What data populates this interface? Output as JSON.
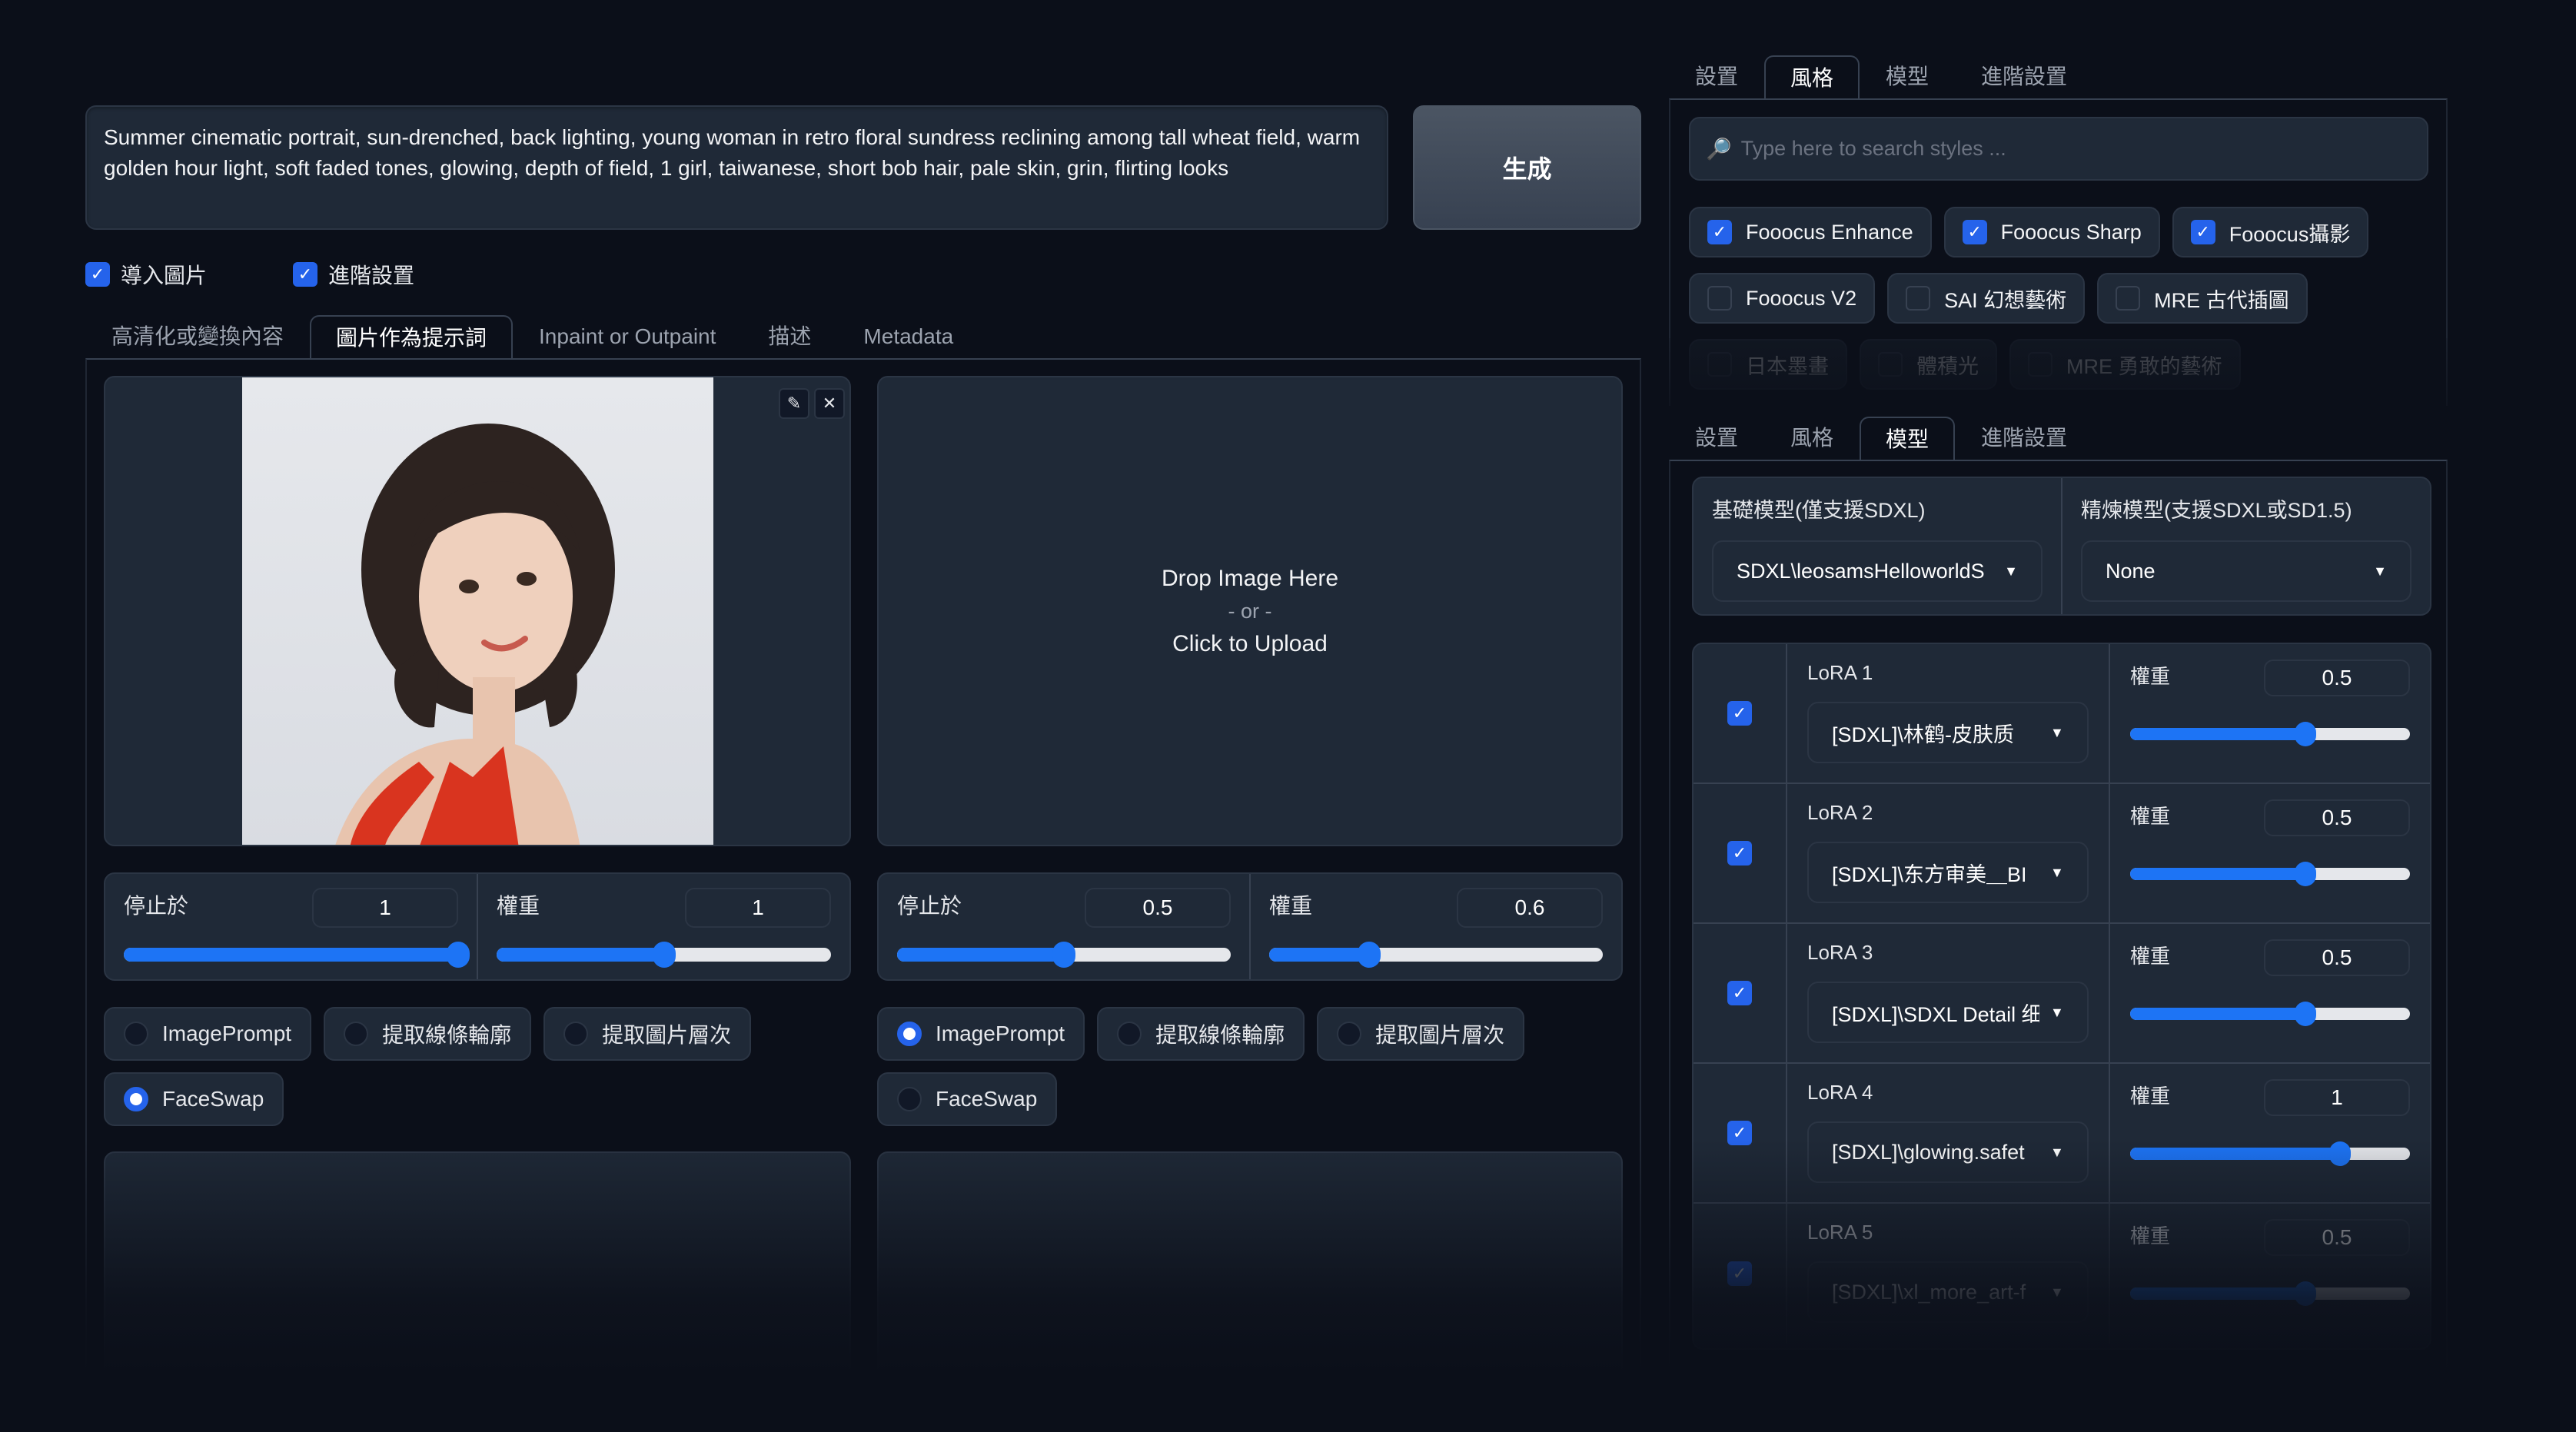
{
  "prompt": {
    "text": "Summer cinematic portrait, sun-drenched, back lighting, young woman in retro floral sundress reclining among tall wheat field, warm golden hour light, soft faded tones, glowing, depth of field, 1 girl, taiwanese, short bob hair, pale skin, grin, flirting looks"
  },
  "generate_button": "生成",
  "options": [
    {
      "label": "導入圖片",
      "checked": true
    },
    {
      "label": "進階設置",
      "checked": true
    }
  ],
  "input_tabs": [
    {
      "label": "高清化或變換內容",
      "active": false
    },
    {
      "label": "圖片作為提示詞",
      "active": true
    },
    {
      "label": "Inpaint or Outpaint",
      "active": false
    },
    {
      "label": "描述",
      "active": false
    },
    {
      "label": "Metadata",
      "active": false
    }
  ],
  "image_slots": [
    {
      "has_image": true,
      "image_alt": "portrait of young woman with short bob hair in red top",
      "stop_at": {
        "label": "停止於",
        "value": "1",
        "fraction": 1.0
      },
      "weight": {
        "label": "權重",
        "value": "1",
        "fraction": 0.5
      },
      "types": [
        {
          "label": "ImagePrompt",
          "selected": false
        },
        {
          "label": "提取線條輪廓",
          "selected": false
        },
        {
          "label": "提取圖片層次",
          "selected": false
        },
        {
          "label": "FaceSwap",
          "selected": true
        }
      ]
    },
    {
      "has_image": false,
      "drop_text": "Drop Image Here",
      "or_text": "- or -",
      "upload_text": "Click to Upload",
      "stop_at": {
        "label": "停止於",
        "value": "0.5",
        "fraction": 0.5
      },
      "weight": {
        "label": "權重",
        "value": "0.6",
        "fraction": 0.3
      },
      "types": [
        {
          "label": "ImagePrompt",
          "selected": true
        },
        {
          "label": "提取線條輪廓",
          "selected": false
        },
        {
          "label": "提取圖片層次",
          "selected": false
        },
        {
          "label": "FaceSwap",
          "selected": false
        }
      ]
    }
  ],
  "settings_tabs_top": [
    {
      "label": "設置",
      "active": false
    },
    {
      "label": "風格",
      "active": true
    },
    {
      "label": "模型",
      "active": false
    },
    {
      "label": "進階設置",
      "active": false
    }
  ],
  "style_search": {
    "placeholder": "Type here to search styles ..."
  },
  "styles": [
    [
      {
        "label": "Fooocus Enhance",
        "checked": true
      },
      {
        "label": "Fooocus Sharp",
        "checked": true
      },
      {
        "label": "Fooocus攝影",
        "checked": true
      }
    ],
    [
      {
        "label": "Fooocus V2",
        "checked": false
      },
      {
        "label": "SAI 幻想藝術",
        "checked": false
      },
      {
        "label": "MRE 古代插圖",
        "checked": false
      }
    ],
    [
      {
        "label": "日本墨畫",
        "checked": false
      },
      {
        "label": "體積光",
        "checked": false
      },
      {
        "label": "MRE 勇敢的藝術",
        "checked": false
      }
    ]
  ],
  "settings_tabs_bottom": [
    {
      "label": "設置",
      "active": false
    },
    {
      "label": "風格",
      "active": false
    },
    {
      "label": "模型",
      "active": true
    },
    {
      "label": "進階設置",
      "active": false
    }
  ],
  "models": {
    "base_label": "基礎模型(僅支援SDXL)",
    "base_value": "SDXL\\leosamsHelloworldS",
    "refiner_label": "精煉模型(支援SDXL或SD1.5)",
    "refiner_value": "None"
  },
  "loras": [
    {
      "label": "LoRA 1",
      "enabled": true,
      "model": "[SDXL]\\林鹤-皮肤质",
      "weight_label": "權重",
      "weight": "0.5",
      "weight_fraction": 0.625
    },
    {
      "label": "LoRA 2",
      "enabled": true,
      "model": "[SDXL]\\东方审美＿BI",
      "weight_label": "權重",
      "weight": "0.5",
      "weight_fraction": 0.625
    },
    {
      "label": "LoRA 3",
      "enabled": true,
      "model": "[SDXL]\\SDXL Detail 细",
      "weight_label": "權重",
      "weight": "0.5",
      "weight_fraction": 0.625
    },
    {
      "label": "LoRA 4",
      "enabled": true,
      "model": "[SDXL]\\glowing.safet",
      "weight_label": "權重",
      "weight": "1",
      "weight_fraction": 0.75
    },
    {
      "label": "LoRA 5",
      "enabled": true,
      "model": "[SDXL]\\xl_more_art-f",
      "weight_label": "權重",
      "weight": "0.5",
      "weight_fraction": 0.625
    }
  ],
  "icons": {
    "check": "✓",
    "search": "🔎",
    "edit": "✎",
    "close": "✕",
    "caret": "▼"
  },
  "colors": {
    "accent": "#2563eb",
    "slider_fill": "#1d74f5",
    "background": "#0b0f19",
    "panel": "#1f2937"
  }
}
